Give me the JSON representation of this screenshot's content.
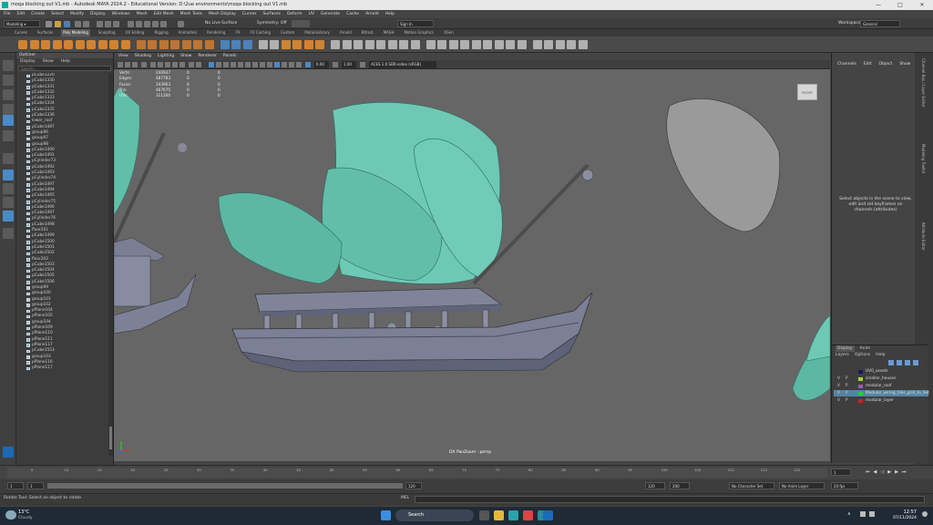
{
  "window": {
    "title": "moqa blocking out V1.mb - Autodesk MAYA 2024.2 - Educational Version: D:\\2ue environments\\moqa blocking out V1.mb"
  },
  "menu": [
    "File",
    "Edit",
    "Create",
    "Select",
    "Modify",
    "Display",
    "Windows",
    "Mesh",
    "Edit Mesh",
    "Mesh Tools",
    "Mesh Display",
    "Curves",
    "Surfaces",
    "Deform",
    "UV",
    "Generate",
    "Cache",
    "Arnold",
    "Help"
  ],
  "statusline": {
    "mode": "Modeling",
    "live": "No Live Surface",
    "symmetry": "Symmetry: Off",
    "signin": "Sign In",
    "workspace_label": "Workspace:",
    "workspace": "General"
  },
  "shelf_tabs": [
    "Curves",
    "Surfaces",
    "Poly Modeling",
    "Sculpting",
    "UV Editing",
    "Rigging",
    "Animation",
    "Rendering",
    "FX",
    "FX Caching",
    "Custom",
    "MotionLibrary",
    "Arnold",
    "Bifrost",
    "MASH",
    "Motion Graphics",
    "XGen"
  ],
  "shelf_active": "Poly Modeling",
  "outliner": {
    "title": "Outliner",
    "menu": [
      "Display",
      "Show",
      "Help"
    ],
    "search_placeholder": "Search...",
    "items": [
      {
        "name": "pCube1220",
        "type": "mesh"
      },
      {
        "name": "pCube1330",
        "type": "mesh"
      },
      {
        "name": "pCube1331",
        "type": "mesh"
      },
      {
        "name": "pCube1332",
        "type": "mesh"
      },
      {
        "name": "pCube1333",
        "type": "mesh"
      },
      {
        "name": "pCube1334",
        "type": "mesh"
      },
      {
        "name": "pCube1335",
        "type": "mesh"
      },
      {
        "name": "pCube1336",
        "type": "mesh"
      },
      {
        "name": "lower_roof",
        "type": "mesh"
      },
      {
        "name": "pCube1487",
        "type": "mesh"
      },
      {
        "name": "group96",
        "type": "group"
      },
      {
        "name": "group97",
        "type": "group"
      },
      {
        "name": "group98",
        "type": "group"
      },
      {
        "name": "pCube1490",
        "type": "mesh"
      },
      {
        "name": "pCube1491",
        "type": "mesh"
      },
      {
        "name": "pCylinder73",
        "type": "mesh"
      },
      {
        "name": "pCube1492",
        "type": "mesh"
      },
      {
        "name": "pCube1493",
        "type": "mesh"
      },
      {
        "name": "pCylinder74",
        "type": "mesh"
      },
      {
        "name": "pCube1497",
        "type": "mesh"
      },
      {
        "name": "pCube1494",
        "type": "mesh"
      },
      {
        "name": "pCube1495",
        "type": "mesh"
      },
      {
        "name": "pCylinder75",
        "type": "mesh"
      },
      {
        "name": "pCube1496",
        "type": "mesh"
      },
      {
        "name": "pCube1497",
        "type": "mesh"
      },
      {
        "name": "pCylinder76",
        "type": "mesh"
      },
      {
        "name": "pCube1498",
        "type": "mesh"
      },
      {
        "name": "floor201",
        "type": "mesh"
      },
      {
        "name": "pCube1499",
        "type": "mesh"
      },
      {
        "name": "pCube1500",
        "type": "mesh"
      },
      {
        "name": "pCube1501",
        "type": "mesh"
      },
      {
        "name": "pCube1502",
        "type": "mesh"
      },
      {
        "name": "floor202",
        "type": "mesh"
      },
      {
        "name": "pCube1503",
        "type": "mesh"
      },
      {
        "name": "pCube1504",
        "type": "mesh"
      },
      {
        "name": "pCube1505",
        "type": "mesh"
      },
      {
        "name": "pCube1506",
        "type": "mesh"
      },
      {
        "name": "group99",
        "type": "group"
      },
      {
        "name": "group100",
        "type": "group"
      },
      {
        "name": "group101",
        "type": "group"
      },
      {
        "name": "group102",
        "type": "group"
      },
      {
        "name": "pPlane104",
        "type": "mesh"
      },
      {
        "name": "pPlane105",
        "type": "mesh"
      },
      {
        "name": "group104",
        "type": "group"
      },
      {
        "name": "pPlane109",
        "type": "mesh"
      },
      {
        "name": "pPlane110",
        "type": "mesh"
      },
      {
        "name": "pPlane111",
        "type": "mesh"
      },
      {
        "name": "pPlane117",
        "type": "mesh"
      },
      {
        "name": "pCube1553",
        "type": "mesh"
      },
      {
        "name": "group103",
        "type": "group"
      },
      {
        "name": "pPlane116",
        "type": "mesh"
      },
      {
        "name": "pPlane117",
        "type": "mesh"
      }
    ]
  },
  "viewport": {
    "menu": [
      "View",
      "Shading",
      "Lighting",
      "Show",
      "Renderer",
      "Panels"
    ],
    "hud": [
      {
        "label": "Verts:",
        "v1": "240937",
        "v2": "0",
        "v3": "0"
      },
      {
        "label": "Edges:",
        "v1": "487783",
        "v2": "0",
        "v3": "0"
      },
      {
        "label": "Faces:",
        "v1": "243963",
        "v2": "0",
        "v3": "0"
      },
      {
        "label": "Tris:",
        "v1": "467675",
        "v2": "0",
        "v3": "0"
      },
      {
        "label": "UVs:",
        "v1": "311260",
        "v2": "0",
        "v3": "0"
      }
    ],
    "camera_label": "DX PanZoom : persp",
    "viewcube": "FRONT",
    "exposure": "0.00",
    "gamma": "1.00",
    "colorspace": "ACES 1.0 SDR-video (sRGB)"
  },
  "channelbox": {
    "menu": [
      "Channels",
      "Edit",
      "Object",
      "Show"
    ],
    "message": "Select objects in the scene to view, edit and set keyframes on channels (attributes)"
  },
  "sidetabs": [
    "Channel Box / Layer Editor",
    "Modeling Toolkit",
    "Attribute Editor"
  ],
  "layers": {
    "tabs": [
      "Display",
      "Anim"
    ],
    "menu": [
      "Layers",
      "Options",
      "Help"
    ],
    "rows": [
      {
        "name": "UV0_assets",
        "color": "#1a1a66",
        "v": "",
        "p": ""
      },
      {
        "name": "smaller_houses",
        "color": "#a8d33a",
        "v": "V",
        "p": "P"
      },
      {
        "name": "modular_roof",
        "color": "#9a55cc",
        "v": "V",
        "p": "P"
      },
      {
        "name": "Modular_wiring_tiles_grid_to_Set",
        "color": "#22cc44",
        "v": "V",
        "p": "P",
        "selected": true
      },
      {
        "name": "modular_layer",
        "color": "#cc2222",
        "v": "V",
        "p": "P"
      }
    ]
  },
  "timeline": {
    "ticks": [
      "5",
      "10",
      "15",
      "20",
      "25",
      "30",
      "35",
      "40",
      "45",
      "50",
      "55",
      "60",
      "65",
      "70",
      "75",
      "80",
      "85",
      "90",
      "95",
      "100",
      "105",
      "110",
      "115",
      "120"
    ],
    "current": "1"
  },
  "range": {
    "start": "1",
    "inner_start": "1",
    "inner_end": "120",
    "end": "120",
    "end2": "200",
    "fps": "24 fps",
    "character": "No Character Set",
    "anim_layer": "No Anim Layer"
  },
  "cmdline": {
    "lang": "MEL",
    "help": "Rotate Tool: Select an object to rotate."
  },
  "taskbar": {
    "temp": "13°C",
    "weather": "Cloudy",
    "search": "Search",
    "time": "12:57",
    "date": "07/11/2024"
  }
}
